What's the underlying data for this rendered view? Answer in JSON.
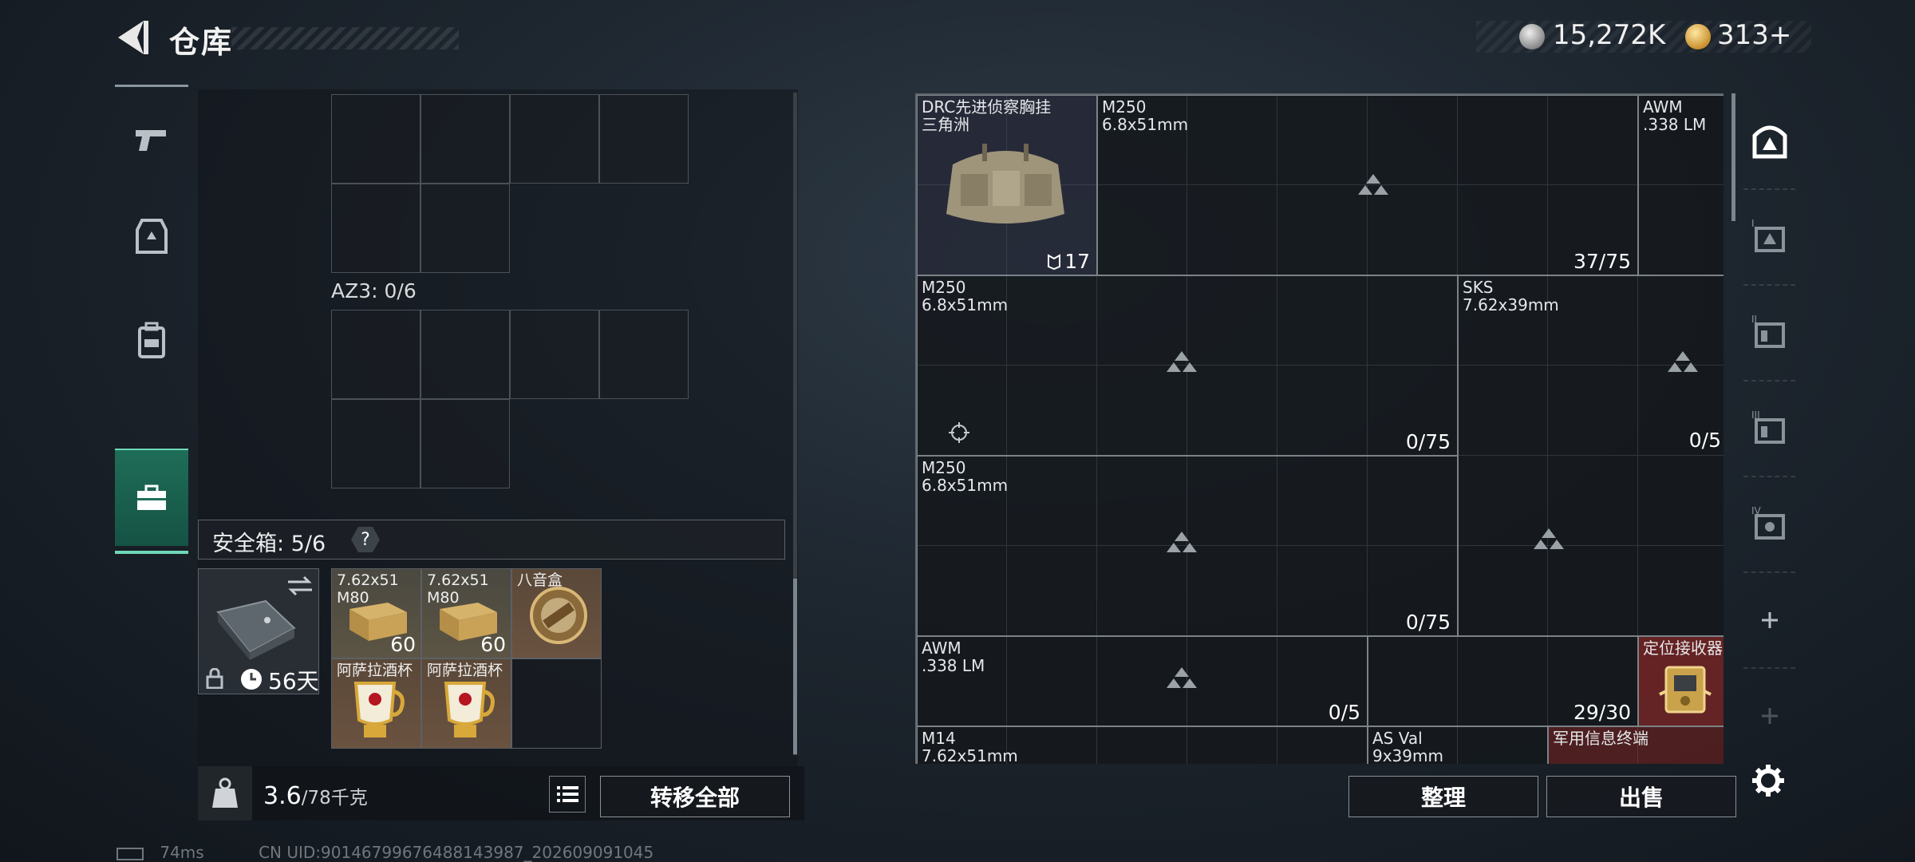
{
  "header": {
    "title": "仓库",
    "currency_silver": "15,272K",
    "currency_gold": "313+"
  },
  "left_nav": [
    "weapons",
    "helmet",
    "backpack",
    "safebox"
  ],
  "left_panel": {
    "container_label": "AZ3: 0/6",
    "safebox_label": "安全箱: 5/6",
    "help": "?",
    "safebox_days": "56天",
    "items": [
      {
        "name": "7.62x51\nM80",
        "count": "60"
      },
      {
        "name": "7.62x51\nM80",
        "count": "60"
      },
      {
        "name": "八音盒",
        "count": ""
      },
      {
        "name": "阿萨拉酒杯",
        "count": ""
      },
      {
        "name": "阿萨拉酒杯",
        "count": ""
      }
    ]
  },
  "bottom": {
    "weight": "3.6",
    "weight_max": "/78千克",
    "transfer_all": "转移全部",
    "sort": "整理",
    "sell": "出售"
  },
  "stash": [
    {
      "name": "DRC先进侦察胸挂\n三角洲",
      "count": "17"
    },
    {
      "name": "M250\n6.8x51mm",
      "count": "37/75"
    },
    {
      "name": "AWM\n.338 LM",
      "count": ""
    },
    {
      "name": "M250\n6.8x51mm",
      "count": "0/75"
    },
    {
      "name": "SKS\n7.62x39mm",
      "count": ""
    },
    {
      "name": "M250\n6.8x51mm",
      "count": "0/75"
    },
    {
      "name": "",
      "count": "0/5"
    },
    {
      "name": "AWM\n.338 LM",
      "count": "0/5"
    },
    {
      "name": "",
      "count": "29/30"
    },
    {
      "name": "定位接收器",
      "count": ""
    },
    {
      "name": "M14\n7.62x51mm",
      "count": ""
    },
    {
      "name": "AS Val\n9x39mm",
      "count": ""
    },
    {
      "name": "军用信息终端",
      "count": ""
    }
  ],
  "right_nav": [
    "delta-home",
    "container-I",
    "container-II",
    "container-III",
    "container-IV",
    "add"
  ],
  "footer": {
    "latency": "74ms",
    "uid": "CN UID:90146799676488143987_202609091045"
  }
}
